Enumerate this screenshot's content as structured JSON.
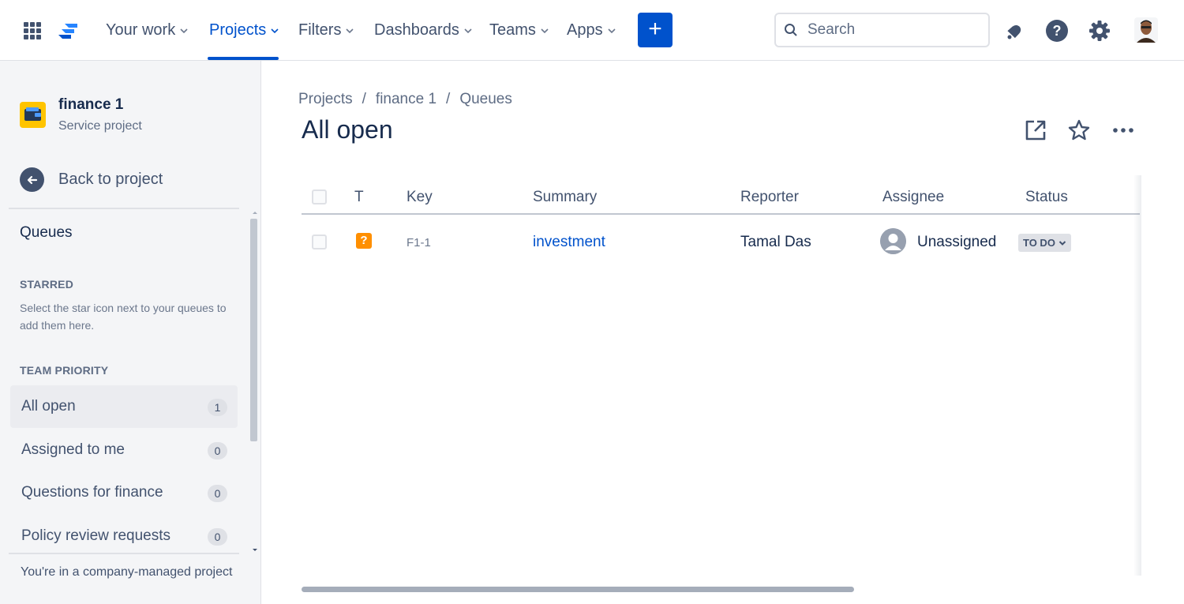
{
  "topnav": {
    "items": [
      {
        "label": "Your work"
      },
      {
        "label": "Projects"
      },
      {
        "label": "Filters"
      },
      {
        "label": "Dashboards"
      },
      {
        "label": "Teams"
      },
      {
        "label": "Apps"
      }
    ],
    "active_item": "Projects",
    "create_label": "+",
    "search_placeholder": "Search",
    "accent_color": "#0052cc"
  },
  "sidebar": {
    "project_name": "finance 1",
    "project_type": "Service project",
    "back_label": "Back to project",
    "queues_heading": "Queues",
    "starred_heading": "STARRED",
    "starred_help": "Select the star icon next to your queues to add them here.",
    "team_priority_heading": "TEAM PRIORITY",
    "queues": [
      {
        "label": "All open",
        "count": "1",
        "selected": true
      },
      {
        "label": "Assigned to me",
        "count": "0"
      },
      {
        "label": "Questions for finance",
        "count": "0"
      },
      {
        "label": "Policy review requests",
        "count": "0"
      }
    ],
    "footer_note": "You're in a company-managed project"
  },
  "main": {
    "breadcrumb": [
      "Projects",
      "finance 1",
      "Queues"
    ],
    "breadcrumb_sep": "/",
    "title": "All open",
    "table": {
      "headers": [
        "T",
        "Key",
        "Summary",
        "Reporter",
        "Assignee",
        "Status"
      ],
      "rows": [
        {
          "type_icon": "?",
          "key": "F1-1",
          "summary": "investment",
          "reporter": "Tamal Das",
          "assignee": "Unassigned",
          "status": "TO DO"
        }
      ]
    }
  }
}
